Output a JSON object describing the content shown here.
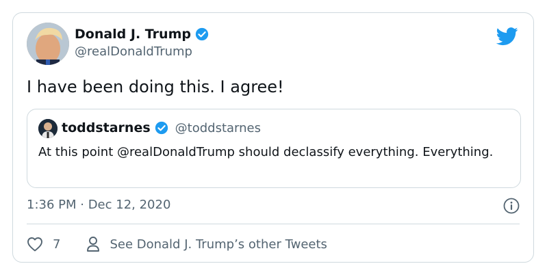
{
  "tweet": {
    "author": {
      "name": "Donald J. Trump",
      "handle": "@realDonaldTrump",
      "verified": true
    },
    "text": "I have been doing this. I agree!",
    "quoted": {
      "name": "toddstarnes",
      "handle": "@toddstarnes",
      "verified": true,
      "text": "At this point @realDonaldTrump should declassify everything. Everything."
    },
    "timestamp": "1:36 PM · Dec 12, 2020",
    "likes": "7",
    "other_tweets_label": "See Donald J. Trump’s other Tweets"
  },
  "icons": {
    "brand": "twitter-bird-icon",
    "verified": "verified-badge-icon",
    "info": "info-icon",
    "like": "heart-icon",
    "profile": "person-icon"
  },
  "colors": {
    "twitter_blue": "#1d9bf0",
    "text_primary": "#0f1419",
    "text_secondary": "#536471",
    "border": "#cfd9de"
  }
}
